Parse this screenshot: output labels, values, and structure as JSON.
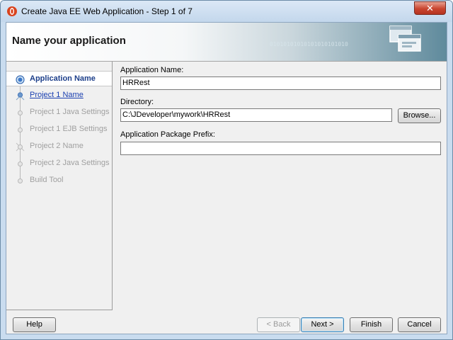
{
  "window": {
    "title": "Create Java EE Web Application - Step 1 of 7",
    "close_label": "✕"
  },
  "banner": {
    "title": "Name your application",
    "binary": "01010101010101010101010"
  },
  "nav": {
    "items": [
      {
        "label": "Application Name",
        "state": "active"
      },
      {
        "label": "Project 1 Name",
        "state": "link"
      },
      {
        "label": "Project 1 Java Settings",
        "state": "disabled"
      },
      {
        "label": "Project 1 EJB Settings",
        "state": "disabled"
      },
      {
        "label": "Project 2 Name",
        "state": "disabled"
      },
      {
        "label": "Project 2 Java Settings",
        "state": "disabled"
      },
      {
        "label": "Build Tool",
        "state": "disabled"
      }
    ]
  },
  "form": {
    "app_name_label": "Application Name:",
    "app_name_value": "HRRest",
    "directory_label": "Directory:",
    "directory_value": "C:\\JDeveloper\\mywork\\HRRest",
    "browse_label": "Browse...",
    "prefix_label": "Application Package Prefix:",
    "prefix_value": ""
  },
  "buttons": {
    "help": "Help",
    "back": "< Back",
    "next": "Next >",
    "finish": "Finish",
    "cancel": "Cancel"
  },
  "colors": {
    "accent": "#1d3f8a",
    "link": "#1a3fb0",
    "disabled": "#a0a0a0"
  }
}
